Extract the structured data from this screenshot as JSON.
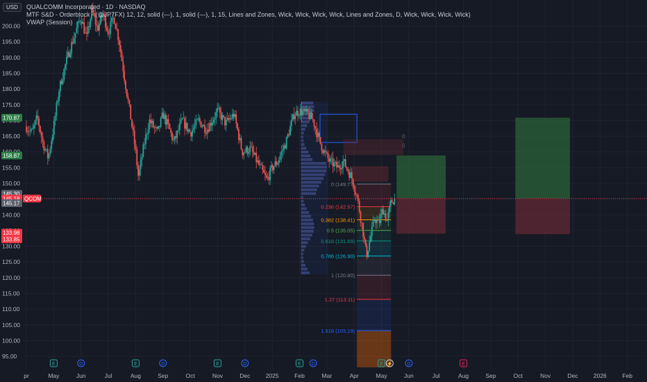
{
  "header": {
    "currency": "USD",
    "line1": "QUALCOMM Incorporated · 1D · NASDAQ",
    "line2": "MTF S&D - Orderblock - (@JP7FX) 12, 12, solid (—), 1, solid (—), 1, 15, Lines and Zones, Wick, Wick, Wick, Wick, Lines and Zones, D, Wick, Wick, Wick, Wick)",
    "line3": "VWAP (Session)"
  },
  "price_tags": [
    {
      "text": "170.87",
      "value": 170.87,
      "color": "#2e7d46"
    },
    {
      "text": "158.87",
      "value": 158.87,
      "color": "#2e7d46"
    },
    {
      "text": "145.30",
      "value": 146.7,
      "color": "#5d606b"
    },
    {
      "text": "QCOM",
      "value": 145.18,
      "color": "#f23645"
    },
    {
      "text": "145.18",
      "value": 145.18,
      "color": "#f23645"
    },
    {
      "text": "145.17",
      "value": 143.7,
      "color": "#5d606b"
    },
    {
      "text": "133.98",
      "value": 134.3,
      "color": "#f23645"
    },
    {
      "text": "133.85",
      "value": 132.2,
      "color": "#f23645"
    }
  ],
  "fib_levels": [
    {
      "label": "0 (149.77)",
      "value": 149.77,
      "color": "#787b86"
    },
    {
      "label": "0.236 (142.57)",
      "value": 142.57,
      "color": "#f23645"
    },
    {
      "label": "0.382 (138.41)",
      "value": 138.41,
      "color": "#ff9800"
    },
    {
      "label": "0.5 (135.05)",
      "value": 135.05,
      "color": "#4caf50"
    },
    {
      "label": "0.618 (131.69)",
      "value": 131.69,
      "color": "#089981"
    },
    {
      "label": "0.786 (126.90)",
      "value": 126.9,
      "color": "#00bcd4"
    },
    {
      "label": "1 (120.80)",
      "value": 120.8,
      "color": "#787b86"
    },
    {
      "label": "1.27 (113.11)",
      "value": 113.11,
      "color": "#f23645"
    },
    {
      "label": "1.618 (103.19)",
      "value": 103.19,
      "color": "#2962ff"
    }
  ],
  "zone_labels": [
    "0",
    "0"
  ],
  "event_markers": [
    {
      "type": "E",
      "month": "May"
    },
    {
      "type": "D",
      "month": "Jun"
    },
    {
      "type": "E",
      "month": "Aug"
    },
    {
      "type": "D",
      "month": "Sep"
    },
    {
      "type": "E",
      "month": "Nov"
    },
    {
      "type": "D",
      "month": "Dec"
    },
    {
      "type": "E",
      "month": "Feb"
    },
    {
      "type": "D",
      "month": "Feb"
    },
    {
      "type": "E",
      "month": "May"
    },
    {
      "type": "lightning",
      "month": "May"
    },
    {
      "type": "D",
      "month": "Jun"
    },
    {
      "type": "E",
      "month": "Aug"
    }
  ],
  "chart_data": {
    "type": "candlestick",
    "title": "QUALCOMM Incorporated · 1D · NASDAQ",
    "symbol": "QCOM",
    "last_price": 145.18,
    "y_ticks": [
      200,
      195,
      190,
      185,
      180,
      175,
      170,
      165,
      160,
      155,
      150,
      145,
      140,
      135,
      130,
      125,
      120,
      115,
      110,
      105,
      100,
      95
    ],
    "y_tick_labels": [
      "200.00",
      "195.00",
      "190.00",
      "185.00",
      "180.00",
      "175.00",
      "170.00",
      "165.00",
      "160.00",
      "155.00",
      "150.00",
      "145.00",
      "140.00",
      "135.00",
      "130.00",
      "125.00",
      "120.00",
      "115.00",
      "110.00",
      "105.00",
      "100.00",
      "95.00"
    ],
    "ylim": [
      91.5,
      206.5
    ],
    "x_tick_labels": [
      "Apr",
      "May",
      "Jun",
      "Jul",
      "Aug",
      "Sep",
      "Oct",
      "Nov",
      "Dec",
      "2025",
      "Feb",
      "Mar",
      "Apr",
      "May",
      "Jun",
      "Jul",
      "Aug",
      "Sep",
      "Oct",
      "Nov",
      "Dec",
      "2026",
      "Feb"
    ],
    "x_tick_months": [
      0,
      1,
      2,
      3,
      4,
      5,
      6,
      7,
      8,
      9,
      10,
      11,
      12,
      13,
      14,
      15,
      16,
      17,
      18,
      19,
      20,
      21,
      22
    ],
    "x_tick_first_text": "pr",
    "price_path": [
      [
        0.0,
        168
      ],
      [
        0.2,
        166
      ],
      [
        0.4,
        171
      ],
      [
        0.6,
        163
      ],
      [
        0.8,
        158
      ],
      [
        1.0,
        168
      ],
      [
        1.2,
        180
      ],
      [
        1.5,
        190
      ],
      [
        1.8,
        198
      ],
      [
        2.0,
        203
      ],
      [
        2.2,
        196
      ],
      [
        2.4,
        205
      ],
      [
        2.6,
        199
      ],
      [
        2.8,
        204
      ],
      [
        3.0,
        198
      ],
      [
        3.2,
        203
      ],
      [
        3.4,
        195
      ],
      [
        3.6,
        183
      ],
      [
        3.8,
        172
      ],
      [
        4.0,
        160
      ],
      [
        4.1,
        152
      ],
      [
        4.3,
        162
      ],
      [
        4.5,
        170
      ],
      [
        4.8,
        166
      ],
      [
        5.0,
        172
      ],
      [
        5.2,
        168
      ],
      [
        5.4,
        163
      ],
      [
        5.7,
        170
      ],
      [
        6.0,
        166
      ],
      [
        6.3,
        170
      ],
      [
        6.6,
        167
      ],
      [
        7.0,
        173
      ],
      [
        7.3,
        169
      ],
      [
        7.6,
        172
      ],
      [
        7.9,
        160
      ],
      [
        8.2,
        161
      ],
      [
        8.5,
        156
      ],
      [
        8.8,
        151
      ],
      [
        9.0,
        155
      ],
      [
        9.2,
        157
      ],
      [
        9.5,
        163
      ],
      [
        9.8,
        172
      ],
      [
        10.0,
        173
      ],
      [
        10.3,
        172
      ],
      [
        10.5,
        170
      ],
      [
        10.7,
        164
      ],
      [
        10.9,
        160
      ],
      [
        11.1,
        157
      ],
      [
        11.4,
        155
      ],
      [
        11.6,
        157
      ],
      [
        11.9,
        152
      ],
      [
        12.1,
        146
      ],
      [
        12.3,
        136
      ],
      [
        12.45,
        127
      ],
      [
        12.6,
        133
      ],
      [
        12.75,
        139
      ],
      [
        12.9,
        137
      ],
      [
        13.05,
        142
      ],
      [
        13.2,
        138
      ],
      [
        13.35,
        144
      ],
      [
        13.5,
        145.18
      ]
    ],
    "horizontal_lines": [
      {
        "value": 145.18,
        "color": "#f23645",
        "style": "dotted"
      }
    ],
    "position_tools": [
      {
        "month_start": 13.55,
        "month_end": 15.35,
        "entry": 145.3,
        "target": 158.87,
        "stop": 133.98
      },
      {
        "month_start": 17.9,
        "month_end": 19.9,
        "entry": 145.17,
        "target": 170.87,
        "stop": 133.85
      }
    ],
    "grid": true
  }
}
